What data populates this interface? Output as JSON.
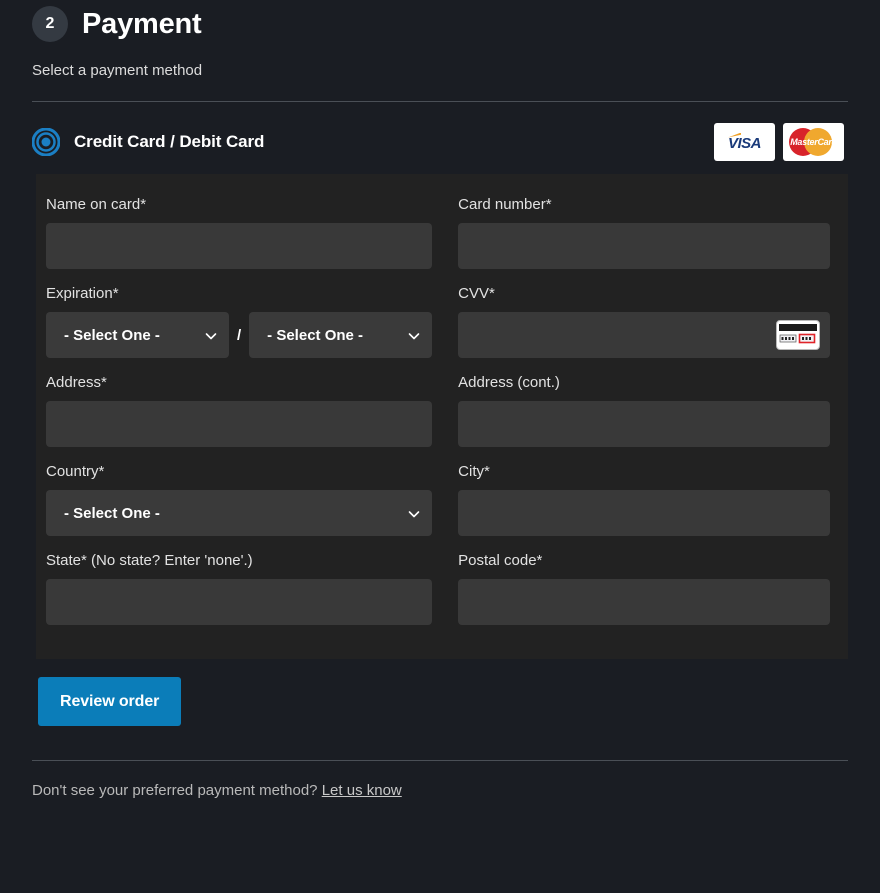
{
  "step": {
    "number": "2",
    "title": "Payment",
    "subtitle": "Select a payment method"
  },
  "method": {
    "label": "Credit Card / Debit Card",
    "radio_icon": "radio-selected-icon",
    "selected": true,
    "logos": [
      {
        "name": "visa-logo",
        "text": "VISA"
      },
      {
        "name": "mastercard-logo",
        "text": "MasterCard"
      }
    ]
  },
  "form": {
    "name_on_card": {
      "label": "Name on card*",
      "value": "",
      "placeholder": ""
    },
    "card_number": {
      "label": "Card number*",
      "value": "",
      "placeholder": ""
    },
    "expiration": {
      "label": "Expiration*",
      "month_value": "- Select One -",
      "year_value": "- Select One -",
      "separator": "/"
    },
    "cvv": {
      "label": "CVV*",
      "value": "",
      "placeholder": "",
      "icon": "card-back-cvv-icon"
    },
    "address": {
      "label": "Address*",
      "value": "",
      "placeholder": ""
    },
    "address_cont": {
      "label": "Address (cont.)",
      "value": "",
      "placeholder": ""
    },
    "country": {
      "label": "Country*",
      "value": "- Select One -"
    },
    "city": {
      "label": "City*",
      "value": "",
      "placeholder": ""
    },
    "state": {
      "label": "State* (No state? Enter 'none'.)",
      "value": "",
      "placeholder": ""
    },
    "postal_code": {
      "label": "Postal code*",
      "value": "",
      "placeholder": ""
    }
  },
  "submit": {
    "label": "Review order"
  },
  "footer": {
    "text": "Don't see your preferred payment method?",
    "link": "Let us know"
  },
  "colors": {
    "page_bg": "#1a1d23",
    "panel_bg": "#222222",
    "input_bg": "#393939",
    "accent_blue": "#0b7db9",
    "radio_blue": "#1b7fc4",
    "badge_bg": "#343a42",
    "divider": "#4a4f56"
  }
}
